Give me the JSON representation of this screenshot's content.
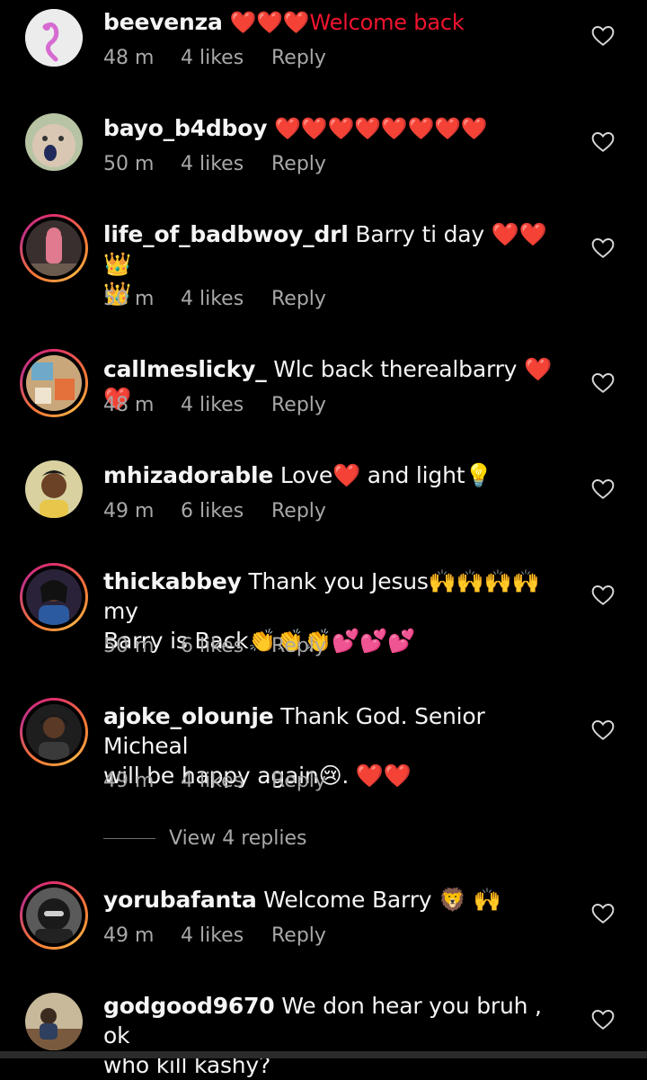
{
  "comments": [
    {
      "username": "beevenza",
      "text": "❤️❤️❤️Welcome back",
      "time": "48 m",
      "likes": "4 likes",
      "reply": "Reply"
    },
    {
      "username": "bayo_b4dboy",
      "text": "❤️❤️❤️❤️❤️❤️❤️❤️",
      "time": "50 m",
      "likes": "4 likes",
      "reply": "Reply"
    },
    {
      "username": "life_of_badbwoy_drl",
      "text": "Barry ti day ❤️❤️👑",
      "text2": "👑",
      "time": "50 m",
      "likes": "4 likes",
      "reply": "Reply"
    },
    {
      "username": "callmeslicky_",
      "text": "Wlc back therealbarry ❤️❤️",
      "time": "48 m",
      "likes": "4 likes",
      "reply": "Reply"
    },
    {
      "username": "mhizadorable",
      "text": "Love❤️ and light💡",
      "time": "49 m",
      "likes": "6 likes",
      "reply": "Reply"
    },
    {
      "username": "thickabbey",
      "text": "Thank you Jesus🙌🙌🙌🙌 my",
      "text2": "Barry is Back👏👏👏💕💕💕",
      "time": "50 m",
      "likes": "6 likes",
      "reply": "Reply"
    },
    {
      "username": "ajoke_olounje",
      "text": "Thank God. Senior Micheal",
      "text2": "will be happy again😢. ❤️❤️",
      "time": "49 m",
      "likes": "4 likes",
      "reply": "Reply"
    },
    {
      "username": "yorubafanta",
      "text": "Welcome Barry 🦁 🙌",
      "time": "49 m",
      "likes": "4 likes",
      "reply": "Reply"
    },
    {
      "username": "godgood9670",
      "text": "We don hear you bruh , ok",
      "text2": "who kill kashy?"
    }
  ],
  "view_replies": "View 4 replies",
  "colors": {
    "background": "#000000",
    "text": "#f5f5f5",
    "meta": "#a8a8a8",
    "heart_emoji": "#f0142f"
  },
  "icons": {
    "like": "heart-outline-icon"
  }
}
